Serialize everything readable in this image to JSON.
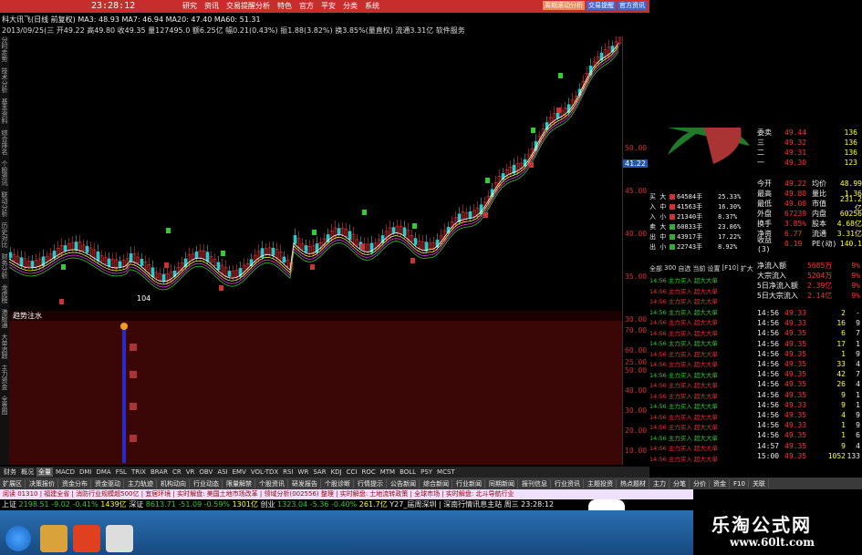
{
  "topbar": {
    "time": "23:28:12",
    "menu": [
      "研究",
      "资讯",
      "交易提醒分析",
      "特色",
      "官方",
      "平安",
      "分类",
      "系统"
    ],
    "right_buttons": [
      "周期滚动分析",
      "交易提醒",
      "官方资讯"
    ]
  },
  "info": {
    "line1": "科大讯飞(日线 前复权) MA3: 48.93  MA7: 46.94  MA20: 47.40  MA60: 51.31",
    "line2": "2013/09/25(三 开49.22 高49.80 收49.35 量127495.0 额6.25亿 幅0.21(0.43%) 振1.88(3.82%) 换3.85%(量直权) 流通3.31亿 软件服务"
  },
  "left_labels": [
    "分时走势",
    "技术分析",
    "基本资料",
    "综合排名",
    "个股资讯",
    "联动分析",
    "历史对比",
    "财务分析",
    "龙虎榜",
    "港股通",
    "大单追踪",
    "主力资金",
    "全景图"
  ],
  "chart_ticks": [
    "50.00",
    "45.00",
    "40.00",
    "35.00",
    "30.00",
    "25.00"
  ],
  "price_box": "41.22",
  "sub_ticks": [
    "70.00",
    "60.00",
    "50.00",
    "40.00",
    "30.00",
    "20.00",
    "10.00"
  ],
  "subpanel_title": "趋势注水",
  "candle_labels": [
    "104",
    "1"
  ],
  "tabs_a": [
    "财务",
    "概况",
    "全量",
    "MACD",
    "DMI",
    "DMA",
    "FSL",
    "TRIX",
    "BRAR",
    "CR",
    "VR",
    "OBV",
    "ASI",
    "EMV",
    "VOL-TDX",
    "RSI",
    "WR",
    "SAR",
    "KDJ",
    "CCI",
    "ROC",
    "MTM",
    "BOLL",
    "PSY",
    "MCST"
  ],
  "tabs_b": [
    "扩展区",
    "决策报价",
    "资金分布",
    "资金驱动",
    "主力轨迹",
    "机构动向",
    "行业动态",
    "限量解禁",
    "个股资讯",
    "研发报告",
    "个股诊断",
    "行情提示",
    "公告新闻",
    "综合新闻",
    "行业新闻",
    "同期新闻",
    "报刊信息",
    "行业资讯",
    "主题投资",
    "热点题材",
    "主力",
    "分笔",
    "分价",
    "资金",
    "F10",
    "关联"
  ],
  "news": "阅读 01310 | 福建全省 | 消防行业规模超500亿 | 宜居环境 | 实时解盘: 美国土地市场改革 | 领域分析(002556) 整理 | 实时解盘: 土地流转政策 | 全球市场 | 实时解盘: 北斗导航行业",
  "status": {
    "sh_label": "上证",
    "sh_val": "2198.51",
    "sh_chg": "-9.02",
    "sh_pct": "-0.41%",
    "sh_amt": "1439亿",
    "sz_label": "深证",
    "sz_val": "8613.71",
    "sz_chg": "-51.09",
    "sz_pct": "-0.59%",
    "sz_amt": "1301亿",
    "cy_label": "创业",
    "cy_val": "1323.04",
    "cy_chg": "-5.36",
    "cy_pct": "-0.40%",
    "cy_amt": "261.7亿",
    "tail": "Y27_届周深圳 | 深南行情讯息主站  周三 23:28:12"
  },
  "right": {
    "pie_colors": [
      "#1f7a2a",
      "#a33"
    ],
    "buy_sell": [
      {
        "label": "委卖",
        "v1": "49.44",
        "v2": "136"
      },
      {
        "label": "三",
        "v1": "49.32",
        "v2": "136"
      },
      {
        "label": "二",
        "v1": "49.31",
        "v2": "136"
      },
      {
        "label": "一",
        "v1": "49.30",
        "v2": "123"
      }
    ],
    "flows": [
      {
        "lbl": "买 大",
        "v": "64584手",
        "p": "25.33%"
      },
      {
        "lbl": "入 中",
        "v": "41563手",
        "p": "16.30%"
      },
      {
        "lbl": "入 小",
        "v": "21340手",
        "p": "8.37%"
      },
      {
        "lbl": "卖 大",
        "v": "60833手",
        "p": "23.86%"
      },
      {
        "lbl": "出 中",
        "v": "43917手",
        "p": "17.22%"
      },
      {
        "lbl": "出 小",
        "v": "22743手",
        "p": "8.92%"
      }
    ],
    "stats": [
      [
        "今开",
        "49.22",
        "均价",
        "48.99"
      ],
      [
        "最高",
        "49.80",
        "量比",
        "1.36"
      ],
      [
        "最低",
        "49.00",
        "市值",
        "231.2亿"
      ],
      [
        "外盘",
        "67239",
        "内盘",
        "60256"
      ],
      [
        "换手",
        "3.85%",
        "股本",
        "4.68亿"
      ],
      [
        "净资",
        "6.77",
        "流通",
        "3.31亿"
      ],
      [
        "收益(3)",
        "0.19",
        "PE(动)",
        "140.1"
      ]
    ],
    "flow_tabs": [
      "全部",
      "300",
      "自选",
      "当前",
      "设置",
      "[F10]",
      "扩大"
    ],
    "netflow": [
      {
        "l": "净流入额",
        "v": "5685万",
        "p": "9%"
      },
      {
        "l": "大宗流入",
        "v": "5204万",
        "p": "9%"
      },
      {
        "l": "5日净流入额",
        "v": "2.39亿",
        "p": "9%"
      },
      {
        "l": "5日大宗流入",
        "v": "2.14亿",
        "p": "9%"
      }
    ],
    "ticks": [
      [
        "14:56",
        "49.33",
        "2",
        "-"
      ],
      [
        "14:56",
        "49.33",
        "16",
        "9"
      ],
      [
        "14:56",
        "49.35",
        "6",
        "7"
      ],
      [
        "14:56",
        "49.35",
        "17",
        "1"
      ],
      [
        "14:56",
        "49.35",
        "1",
        "9"
      ],
      [
        "14:56",
        "49.35",
        "33",
        "4"
      ],
      [
        "14:56",
        "49.35",
        "42",
        "7"
      ],
      [
        "14:56",
        "49.35",
        "26",
        "4"
      ],
      [
        "14:56",
        "49.35",
        "9",
        "1"
      ],
      [
        "14:56",
        "49.33",
        "9",
        "1"
      ],
      [
        "14:56",
        "49.35",
        "4",
        "9"
      ],
      [
        "14:56",
        "49.33",
        "1",
        "9"
      ],
      [
        "14:56",
        "49.35",
        "1",
        "6"
      ],
      [
        "14:57",
        "49.35",
        "9",
        "4"
      ],
      [
        "15:00",
        "49.35",
        "1052",
        "133"
      ]
    ],
    "trades_label": "14:56 主力买入 超大大单"
  },
  "watermark": {
    "cn": "乐淘公式网",
    "url": "www.60lt.com"
  }
}
